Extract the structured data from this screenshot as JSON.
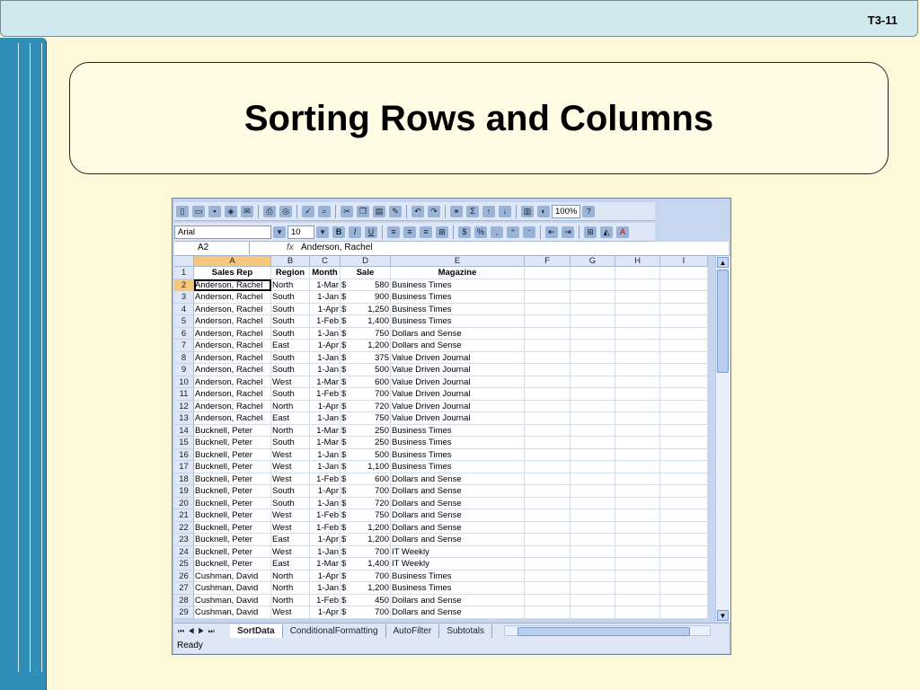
{
  "slide": {
    "id": "T3-11",
    "title": "Sorting Rows and Columns"
  },
  "excel": {
    "font_name": "Arial",
    "font_size": "10",
    "zoom": "100%",
    "name_box": "A2",
    "fx_label": "fx",
    "formula_value": "Anderson, Rachel",
    "columns": [
      "A",
      "B",
      "C",
      "D",
      "E",
      "F",
      "G",
      "H",
      "I"
    ],
    "headers": [
      "Sales Rep",
      "Region",
      "Month",
      "Sale",
      "Magazine"
    ],
    "currency_symbol": "$",
    "rows": [
      [
        "2",
        "Anderson, Rachel",
        "North",
        "1-Mar",
        "580",
        "Business Times"
      ],
      [
        "3",
        "Anderson, Rachel",
        "South",
        "1-Jan",
        "900",
        "Business Times"
      ],
      [
        "4",
        "Anderson, Rachel",
        "South",
        "1-Apr",
        "1,250",
        "Business Times"
      ],
      [
        "5",
        "Anderson, Rachel",
        "South",
        "1-Feb",
        "1,400",
        "Business Times"
      ],
      [
        "6",
        "Anderson, Rachel",
        "South",
        "1-Jan",
        "750",
        "Dollars and Sense"
      ],
      [
        "7",
        "Anderson, Rachel",
        "East",
        "1-Apr",
        "1,200",
        "Dollars and Sense"
      ],
      [
        "8",
        "Anderson, Rachel",
        "South",
        "1-Jan",
        "375",
        "Value Driven Journal"
      ],
      [
        "9",
        "Anderson, Rachel",
        "South",
        "1-Jan",
        "500",
        "Value Driven Journal"
      ],
      [
        "10",
        "Anderson, Rachel",
        "West",
        "1-Mar",
        "600",
        "Value Driven Journal"
      ],
      [
        "11",
        "Anderson, Rachel",
        "South",
        "1-Feb",
        "700",
        "Value Driven Journal"
      ],
      [
        "12",
        "Anderson, Rachel",
        "North",
        "1-Apr",
        "720",
        "Value Driven Journal"
      ],
      [
        "13",
        "Anderson, Rachel",
        "East",
        "1-Jan",
        "750",
        "Value Driven Journal"
      ],
      [
        "14",
        "Bucknell, Peter",
        "North",
        "1-Mar",
        "250",
        "Business Times"
      ],
      [
        "15",
        "Bucknell, Peter",
        "South",
        "1-Mar",
        "250",
        "Business Times"
      ],
      [
        "16",
        "Bucknell, Peter",
        "West",
        "1-Jan",
        "500",
        "Business Times"
      ],
      [
        "17",
        "Bucknell, Peter",
        "West",
        "1-Jan",
        "1,100",
        "Business Times"
      ],
      [
        "18",
        "Bucknell, Peter",
        "West",
        "1-Feb",
        "600",
        "Dollars and Sense"
      ],
      [
        "19",
        "Bucknell, Peter",
        "South",
        "1-Apr",
        "700",
        "Dollars and Sense"
      ],
      [
        "20",
        "Bucknell, Peter",
        "South",
        "1-Jan",
        "720",
        "Dollars and Sense"
      ],
      [
        "21",
        "Bucknell, Peter",
        "West",
        "1-Feb",
        "750",
        "Dollars and Sense"
      ],
      [
        "22",
        "Bucknell, Peter",
        "West",
        "1-Feb",
        "1,200",
        "Dollars and Sense"
      ],
      [
        "23",
        "Bucknell, Peter",
        "East",
        "1-Apr",
        "1,200",
        "Dollars and Sense"
      ],
      [
        "24",
        "Bucknell, Peter",
        "West",
        "1-Jan",
        "700",
        "IT Weekly"
      ],
      [
        "25",
        "Bucknell, Peter",
        "East",
        "1-Mar",
        "1,400",
        "IT Weekly"
      ],
      [
        "26",
        "Cushman, David",
        "North",
        "1-Apr",
        "700",
        "Business Times"
      ],
      [
        "27",
        "Cushman, David",
        "North",
        "1-Jan",
        "1,200",
        "Business Times"
      ],
      [
        "28",
        "Cushman, David",
        "North",
        "1-Feb",
        "450",
        "Dollars and Sense"
      ],
      [
        "29",
        "Cushman, David",
        "West",
        "1-Apr",
        "700",
        "Dollars and Sense"
      ]
    ],
    "sheet_tabs": [
      "SortData",
      "ConditionalFormatting",
      "AutoFilter",
      "Subtotals"
    ],
    "status": "Ready"
  }
}
